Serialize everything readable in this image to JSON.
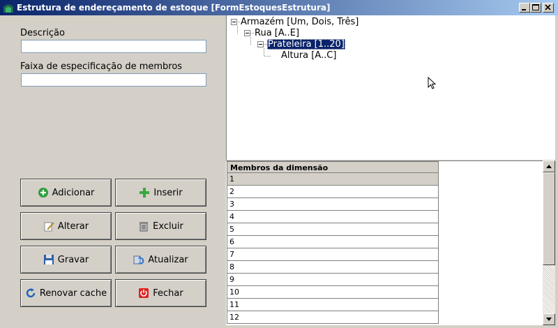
{
  "window": {
    "title": "Estrutura de endereçamento de estoque [FormEstoquesEstrutura]"
  },
  "form": {
    "descricao_label": "Descrição",
    "descricao_value": "",
    "faixa_label": "Faixa de especificação de membros",
    "faixa_value": ""
  },
  "buttons": {
    "adicionar": "Adicionar",
    "inserir": "Inserir",
    "alterar": "Alterar",
    "excluir": "Excluir",
    "gravar": "Gravar",
    "atualizar": "Atualizar",
    "renovar_cache": "Renovar cache",
    "fechar": "Fechar"
  },
  "tree": {
    "nodes": [
      {
        "label": "Armazém [Um, Dois, Três]",
        "level": 0,
        "expanded": true
      },
      {
        "label": "Rua [A..E]",
        "level": 1,
        "expanded": true
      },
      {
        "label": "Prateleira [1..20]",
        "level": 2,
        "expanded": true,
        "selected": true
      },
      {
        "label": "Altura [A..C]",
        "level": 3
      }
    ]
  },
  "grid": {
    "header": "Membros da dimensão",
    "rows": [
      "1",
      "2",
      "3",
      "4",
      "5",
      "6",
      "7",
      "8",
      "9",
      "10",
      "11",
      "12"
    ],
    "current_row": 0
  },
  "colors": {
    "titlebar_start": "#0a246a",
    "titlebar_end": "#a6caf0",
    "selection": "#0a246a",
    "face": "#d4d0c8"
  }
}
